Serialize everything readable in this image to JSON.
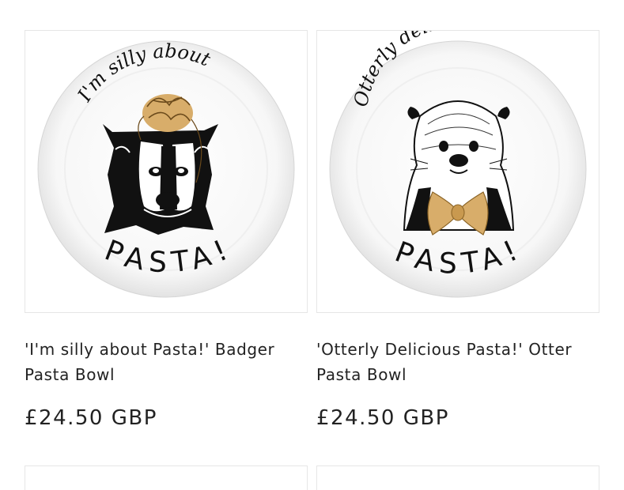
{
  "products": [
    {
      "image_alt": "Badger pasta bowl",
      "plate_top_text": "I'm silly about",
      "plate_bottom_text": "PASTA!",
      "title": "'I'm silly about Pasta!' Badger Pasta Bowl",
      "price": "£24.50 GBP"
    },
    {
      "image_alt": "Otter pasta bowl",
      "plate_top_text": "Otterly delicious",
      "plate_bottom_text": "PASTA!",
      "title": "'Otterly Delicious Pasta!' Otter Pasta Bowl",
      "price": "£24.50 GBP"
    }
  ],
  "colors": {
    "text": "#222222",
    "border": "#e6e6e6",
    "pasta_gold": "#d8ad6a"
  }
}
